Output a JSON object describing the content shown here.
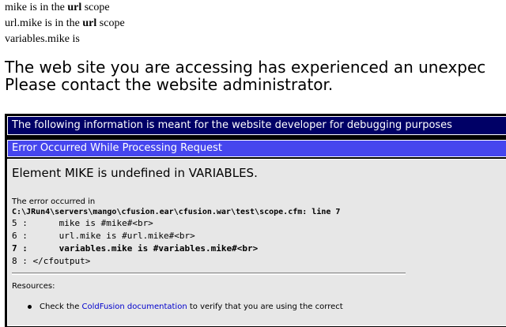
{
  "scope_lines": [
    {
      "pre": "mike is in the ",
      "bold": "url",
      "post": " scope"
    },
    {
      "pre": "url.mike is in the ",
      "bold": "url",
      "post": " scope"
    },
    {
      "pre": "variables.mike is",
      "bold": "",
      "post": ""
    }
  ],
  "headline": {
    "line1": "The web site you are accessing has experienced an unexpec",
    "line2": "Please contact the website administrator."
  },
  "dev_bar": "The following information is meant for the website developer for debugging purposes",
  "error_bar": "Error Occurred While Processing Request",
  "error": {
    "message": "Element MIKE is undefined in VARIABLES.",
    "occurred": "The error occurred in",
    "file": "C:\\JRun4\\servers\\mango\\cfusion.ear\\cfusion.war\\test\\scope.cfm: line 7"
  },
  "code_lines": [
    {
      "text": "5 :      mike is #mike#<br>",
      "bold": false
    },
    {
      "text": "6 :      url.mike is #url.mike#<br>",
      "bold": false
    },
    {
      "text": "7 :      variables.mike is #variables.mike#<br>",
      "bold": true
    },
    {
      "text": "8 : </cfoutput>",
      "bold": false
    }
  ],
  "resources": {
    "label": "Resources:",
    "bullet_pre": "Check the ",
    "bullet_link": "ColdFusion documentation",
    "bullet_post": " to verify that you are using the correct"
  },
  "colors": {
    "dev_bar_bg": "#000066",
    "error_bar_bg": "#4646ee",
    "panel_bg": "#e7e7e7",
    "link": "#0000cc"
  }
}
